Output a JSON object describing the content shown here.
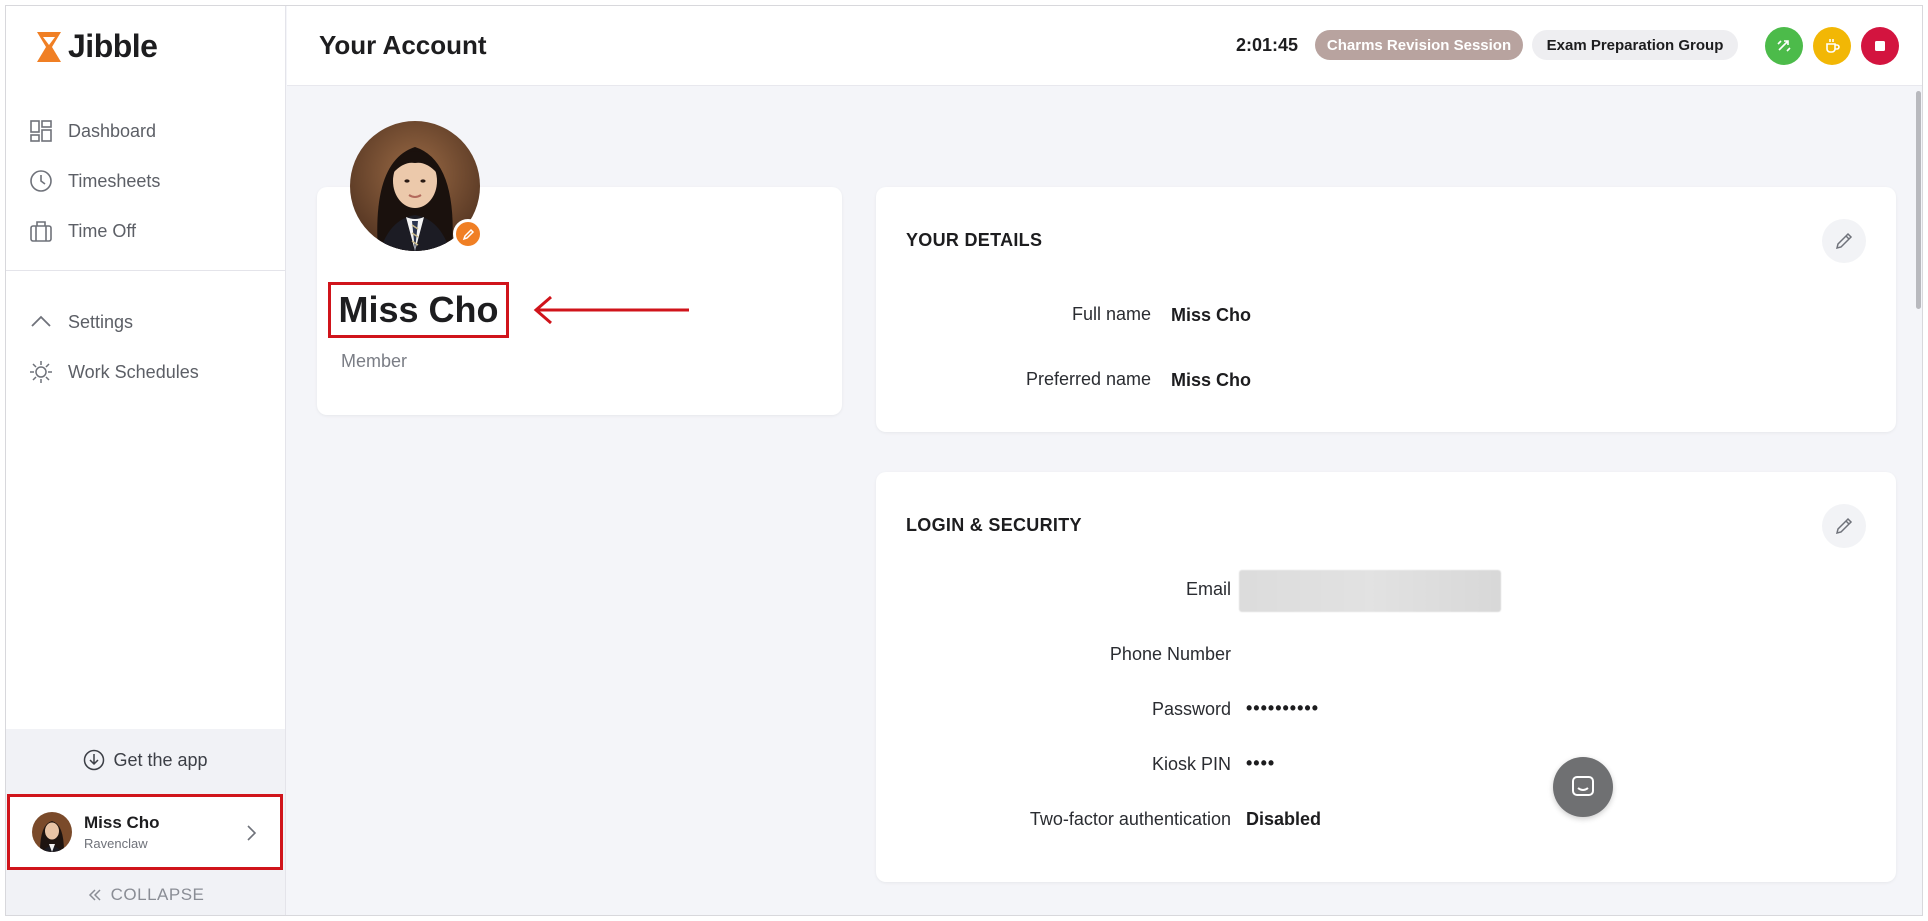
{
  "app": {
    "name": "Jibble"
  },
  "sidebar": {
    "nav_primary": [
      {
        "label": "Dashboard",
        "icon": "dashboard-icon"
      },
      {
        "label": "Timesheets",
        "icon": "clock-icon"
      },
      {
        "label": "Time Off",
        "icon": "suitcase-icon"
      }
    ],
    "nav_secondary": [
      {
        "label": "Settings",
        "icon": "chevron-up-icon"
      },
      {
        "label": "Work Schedules",
        "icon": "gear-sun-icon"
      }
    ],
    "get_app_label": "Get the app",
    "user": {
      "name": "Miss Cho",
      "team": "Ravenclaw"
    },
    "collapse_label": "COLLAPSE"
  },
  "header": {
    "title": "Your Account",
    "timer": "2:01:45",
    "activity": "Charms Revision Session",
    "project": "Exam Preparation Group",
    "colors": {
      "activity_pill": "#b8a39f",
      "switch": "#4cbb4a",
      "break": "#f2b705",
      "stop": "#d3143f"
    }
  },
  "profile": {
    "name": "Miss Cho",
    "role": "Member"
  },
  "details": {
    "title": "YOUR DETAILS",
    "fields": [
      {
        "label": "Full name",
        "value": "Miss Cho"
      },
      {
        "label": "Preferred name",
        "value": "Miss Cho"
      }
    ]
  },
  "security": {
    "title": "LOGIN & SECURITY",
    "email_label": "Email",
    "phone_label": "Phone Number",
    "phone_value": "",
    "password_label": "Password",
    "password_value": "••••••••••",
    "pin_label": "Kiosk PIN",
    "pin_value": "••••",
    "twofa_label": "Two-factor authentication",
    "twofa_value": "Disabled"
  },
  "accent": "#f07f24",
  "highlight": "#d0141b"
}
